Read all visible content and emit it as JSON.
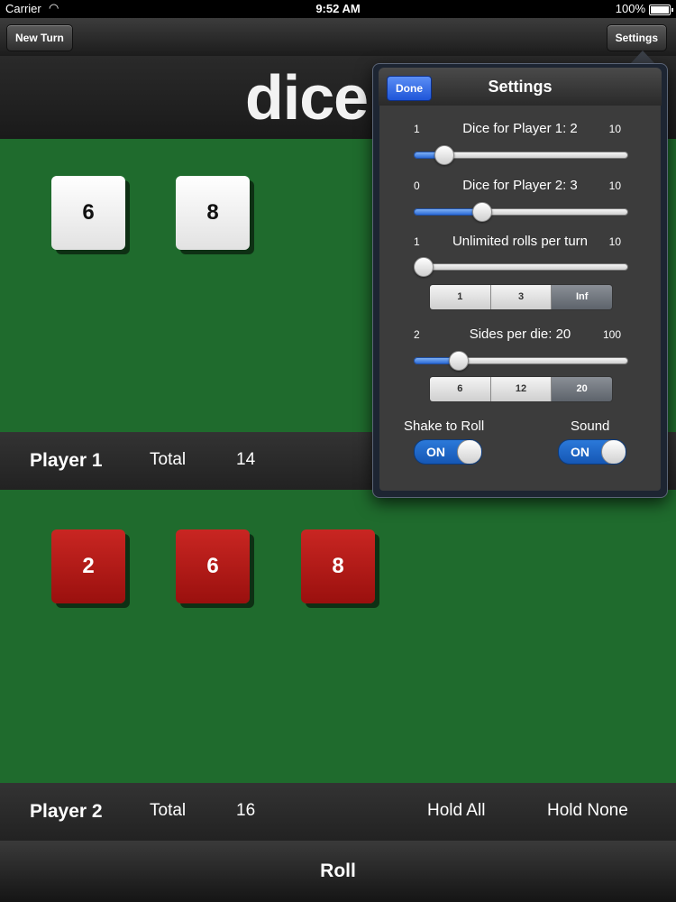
{
  "status_bar": {
    "carrier": "Carrier",
    "time": "9:52 AM",
    "battery": "100%"
  },
  "navbar": {
    "new_turn": "New Turn",
    "settings": "Settings"
  },
  "header": {
    "logo": "dice"
  },
  "player1": {
    "name": "Player 1",
    "total_label": "Total",
    "total": "14",
    "dice": [
      "6",
      "8"
    ]
  },
  "player2": {
    "name": "Player 2",
    "total_label": "Total",
    "total": "16",
    "dice": [
      "2",
      "6",
      "8"
    ],
    "hold_all": "Hold All",
    "hold_none": "Hold None"
  },
  "roll_label": "Roll",
  "settings": {
    "title": "Settings",
    "done": "Done",
    "dice_p1": {
      "label": "Dice for Player 1:  2",
      "min": "1",
      "max": "10",
      "value": 2
    },
    "dice_p2": {
      "label": "Dice for Player 2:  3",
      "min": "0",
      "max": "10",
      "value": 3
    },
    "rolls": {
      "label": "Unlimited rolls per turn",
      "min": "1",
      "max": "10",
      "value": 1,
      "options": [
        "1",
        "3",
        "Inf"
      ],
      "selected": "Inf"
    },
    "sides": {
      "label": "Sides per die: 20",
      "min": "2",
      "max": "100",
      "value": 20,
      "options": [
        "6",
        "12",
        "20"
      ],
      "selected": "20"
    },
    "shake": {
      "label": "Shake to Roll",
      "state": "ON"
    },
    "sound": {
      "label": "Sound",
      "state": "ON"
    }
  },
  "colors": {
    "felt": "#1f6b2d",
    "red_die": "#b81b18",
    "white_die": "#f2f2f2",
    "accent_blue": "#2b79d9"
  }
}
